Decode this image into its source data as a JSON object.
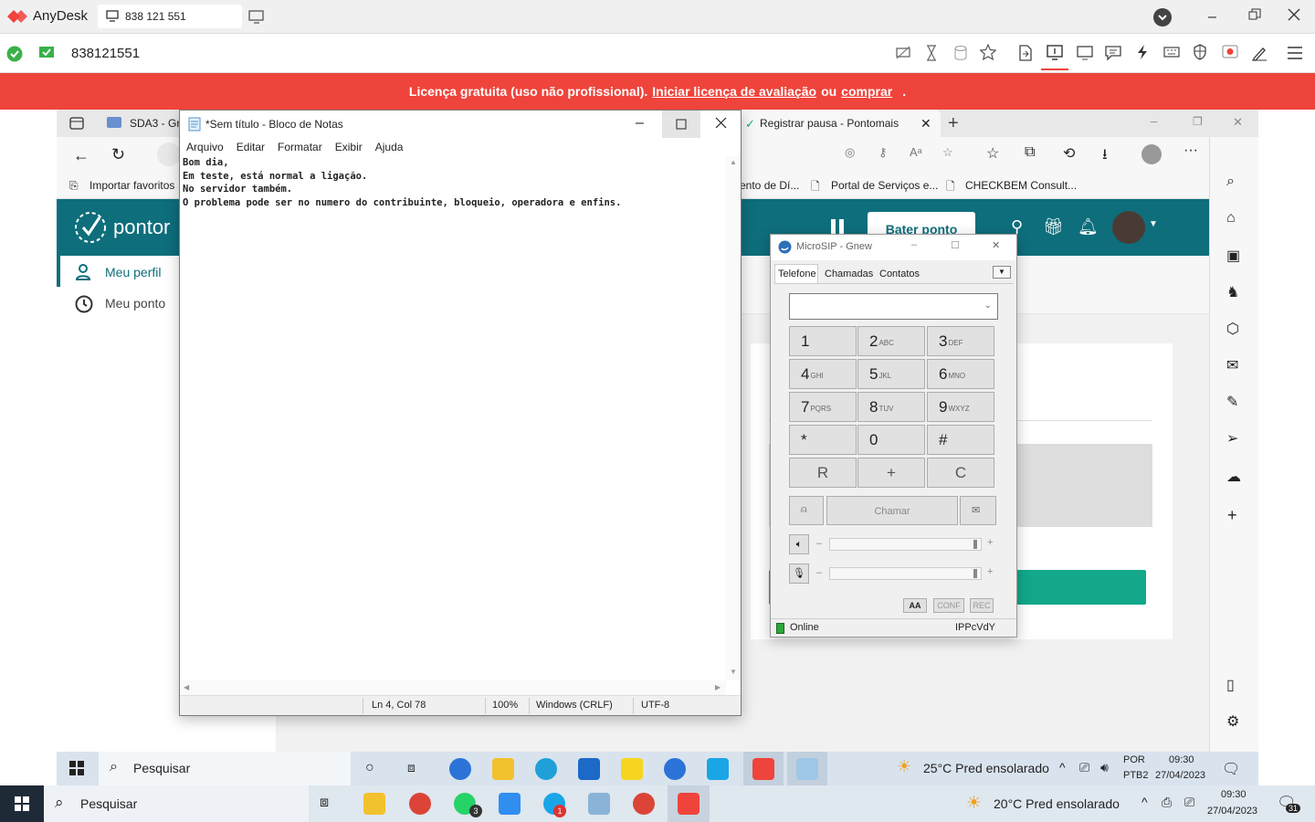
{
  "anydesk": {
    "app_name": "AnyDesk",
    "tab_label": "838 121 551",
    "address_value": "838121551",
    "banner": {
      "prefix": "Licença gratuita (uso não profissional).",
      "trial_link": "Iniciar licença de avaliação",
      "or": "ou",
      "buy_link": "comprar",
      "suffix": "."
    },
    "colors": {
      "banner": "#ef443b",
      "brand": "#ef443b"
    }
  },
  "edge": {
    "tab1": "SDA3 - Gr",
    "tab2": "Registrar pausa - Pontomais",
    "fav_import": "Importar favoritos",
    "fav1": "ento de Dí...",
    "fav2": "Portal de Serviços e...",
    "fav3": "CHECKBEM Consult..."
  },
  "ponto": {
    "logo": "pontor",
    "bater_ponto": "Bater ponto",
    "menu": [
      "Meu perfil",
      "Meu ponto"
    ],
    "accent": "#0e6e7c",
    "button_green": "#13a88a"
  },
  "notepad": {
    "title": "*Sem título - Bloco de Notas",
    "menu": [
      "Arquivo",
      "Editar",
      "Formatar",
      "Exibir",
      "Ajuda"
    ],
    "lines": [
      "Bom dia,",
      "Em teste, está normal a ligação.",
      "No servidor também.",
      "O problema pode ser no numero do contribuinte, bloqueio, operadora e enfins."
    ],
    "status": {
      "position": "Ln 4, Col 78",
      "zoom": "100%",
      "eol": "Windows (CRLF)",
      "encoding": "UTF-8"
    }
  },
  "microsip": {
    "title": "MicroSIP - Gnew",
    "tabs": [
      "Telefone",
      "Chamadas",
      "Contatos"
    ],
    "keys": [
      {
        "d": "1",
        "s": ""
      },
      {
        "d": "2",
        "s": "ABC"
      },
      {
        "d": "3",
        "s": "DEF"
      },
      {
        "d": "4",
        "s": "GHI"
      },
      {
        "d": "5",
        "s": "JKL"
      },
      {
        "d": "6",
        "s": "MNO"
      },
      {
        "d": "7",
        "s": "PQRS"
      },
      {
        "d": "8",
        "s": "TUV"
      },
      {
        "d": "9",
        "s": "WXYZ"
      },
      {
        "d": "*",
        "s": ""
      },
      {
        "d": "0",
        "s": ""
      },
      {
        "d": "#",
        "s": ""
      }
    ],
    "fn_keys": [
      "R",
      "+",
      "C"
    ],
    "call_label": "Chamar",
    "minus": "–",
    "plus": "+",
    "aa": "AA",
    "conf": "CONF",
    "rec": "REC",
    "status": "Online",
    "account": "IPPcVdY"
  },
  "remote_taskbar": {
    "search": "Pesquisar",
    "weather": "25°C  Pred ensolarado",
    "lang1": "POR",
    "lang2": "PTB2",
    "time": "09:30",
    "date": "27/04/2023"
  },
  "local_taskbar": {
    "search": "Pesquisar",
    "weather": "20°C  Pred ensolarado",
    "time": "09:30",
    "date": "27/04/2023",
    "notif_count": "31",
    "whatsapp_badge": "3",
    "skype_badge": "1"
  }
}
